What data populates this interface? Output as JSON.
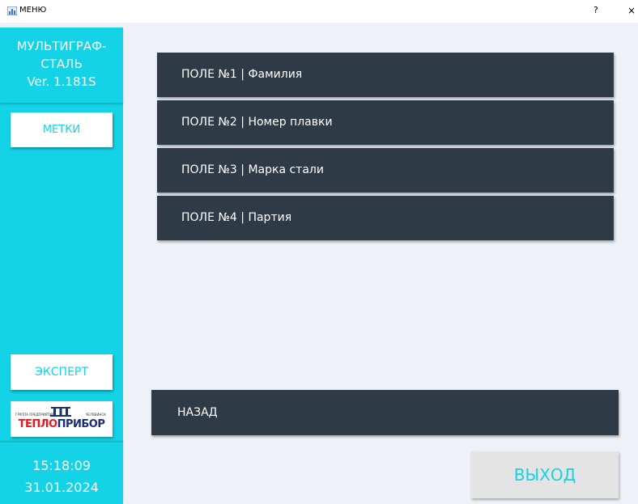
{
  "window": {
    "title": "МЕНЮ",
    "help_label": "?",
    "close_label": "×"
  },
  "sidebar": {
    "app_name_line1": "МУЛЬТИГРАФ-",
    "app_name_line2": "СТАЛЬ",
    "version": "Ver. 1.181S",
    "marks_label": "МЕТКИ",
    "expert_label": "ЭКСПЕРТ",
    "logo": {
      "small_left": "ГРУППА ПРЕДПРИЯТИЙ",
      "small_right": "ЧЕЛЯБИНСК",
      "part1": "ТЕПЛО",
      "part2": "ПРИБОР",
      "color_red": "#e21b23",
      "color_blue": "#1b2f7a"
    },
    "time": "15:18:09",
    "date": "31.01.2024"
  },
  "fields": [
    {
      "label": "ПОЛЕ №1 | Фамилия"
    },
    {
      "label": "ПОЛЕ №2 | Номер плавки"
    },
    {
      "label": "ПОЛЕ №3 | Марка стали"
    },
    {
      "label": "ПОЛЕ №4 | Партия"
    }
  ],
  "back_label": "НАЗАД",
  "exit_label": "ВЫХОД",
  "colors": {
    "accent": "#14d3e6",
    "button_dark": "#2e3a46",
    "background": "#eef1f8"
  }
}
